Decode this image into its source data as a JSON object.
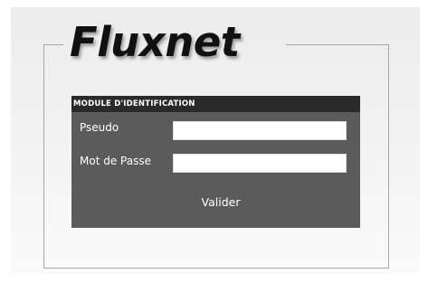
{
  "brand": {
    "logo_text": "Fluxnet"
  },
  "login": {
    "header": "MODULE D'IDENTIFICATION",
    "username_label": "Pseudo",
    "username_value": "",
    "password_label": "Mot de Passe",
    "password_value": "",
    "submit_label": "Valider"
  },
  "colors": {
    "panel_bg": "#5b5b5b",
    "panel_header_bg": "#2a2a2a",
    "frame_line": "#a6a6a6"
  }
}
